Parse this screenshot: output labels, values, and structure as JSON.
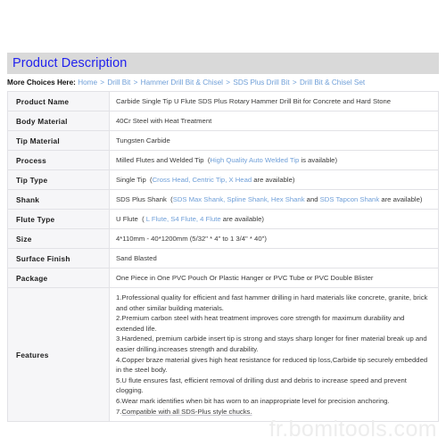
{
  "section": {
    "title": "Product Description"
  },
  "breadcrumb": {
    "label": "More Choices Here",
    "separator": ">",
    "items": [
      "Home",
      "Drill Bit",
      "Hammer Drill Bit & Chisel",
      "SDS Plus Drill Bit",
      "Drill Bit & Chisel Set"
    ]
  },
  "spec_table": {
    "rows": [
      {
        "label": "Product Name",
        "value": "Carbide Single Tip U Flute SDS Plus Rotary Hammer Drill Bit for Concrete and Hard Stone"
      },
      {
        "label": "Body Material",
        "value": "40Cr Steel with Heat Treatment"
      },
      {
        "label": "Tip Material",
        "value": "Tungsten Carbide"
      },
      {
        "label": "Process",
        "value_main": "Milled Flutes and Welded Tip",
        "value_paren_open": "(",
        "value_alt": "High Quality Auto Welded Tip",
        "value_tail": " is available)"
      },
      {
        "label": "Tip Type",
        "value_main": "Single Tip",
        "value_paren_open": "(",
        "value_alt": "Cross Head, Centric Tip, X Head",
        "value_tail": " are available)"
      },
      {
        "label": "Shank",
        "value_main": "SDS Plus Shank",
        "value_paren_open": "(",
        "value_alt": "SDS Max Shank, Spline Shank, Hex Shank",
        "value_mid": " and ",
        "value_alt2": "SDS Tapcon Shank",
        "value_tail": " are available)"
      },
      {
        "label": "Flute Type",
        "value_main": "U Flute",
        "value_paren_open": "(",
        "value_alt": " L Flute, S4 Flute, 4 Flute",
        "value_tail": " are available)"
      },
      {
        "label": "Size",
        "value": "4*110mm - 40*1200mm  (5/32\" * 4\" to 1 3/4\" * 40\")"
      },
      {
        "label": "Surface Finish",
        "value": "Sand Blasted"
      },
      {
        "label": "Package",
        "value": "One Piece in One PVC Pouch Or Plastic Hanger or PVC Tube or PVC Double Blister"
      }
    ],
    "features": {
      "label": "Features",
      "lines": [
        "1.Professional quality for efficient and fast hammer drilling in hard materials like concrete, granite, brick and other similar building materials.",
        "2.Premium carbon steel with heat treatment improves core strength for maximum durability and extended life.",
        "3.Hardened, premium carbide insert tip is strong and stays sharp longer for finer material break up and easier drilling.increases strength and durability.",
        "4.Copper braze material gives high heat resistance for reduced tip loss,Carbide tip securely embedded in the steel body.",
        "5.U flute ensures fast, efficient removal of drilling dust and debris to increase speed and prevent clogging.",
        "6.Wear mark identifies when bit has worn to an inappropriate level for precision anchoring."
      ],
      "last_line_number": "7.",
      "last_line_text": "Compatible with all SDS-Plus style chucks."
    }
  },
  "watermark": {
    "text": "fr.bomitools.com"
  },
  "colors": {
    "header_bar": "#d9d9d9",
    "header_title": "#2222ee",
    "link": "#6f9fd8",
    "label_bg": "#f6f6f8",
    "border": "#e2e2e6",
    "watermark": "#ededed"
  }
}
